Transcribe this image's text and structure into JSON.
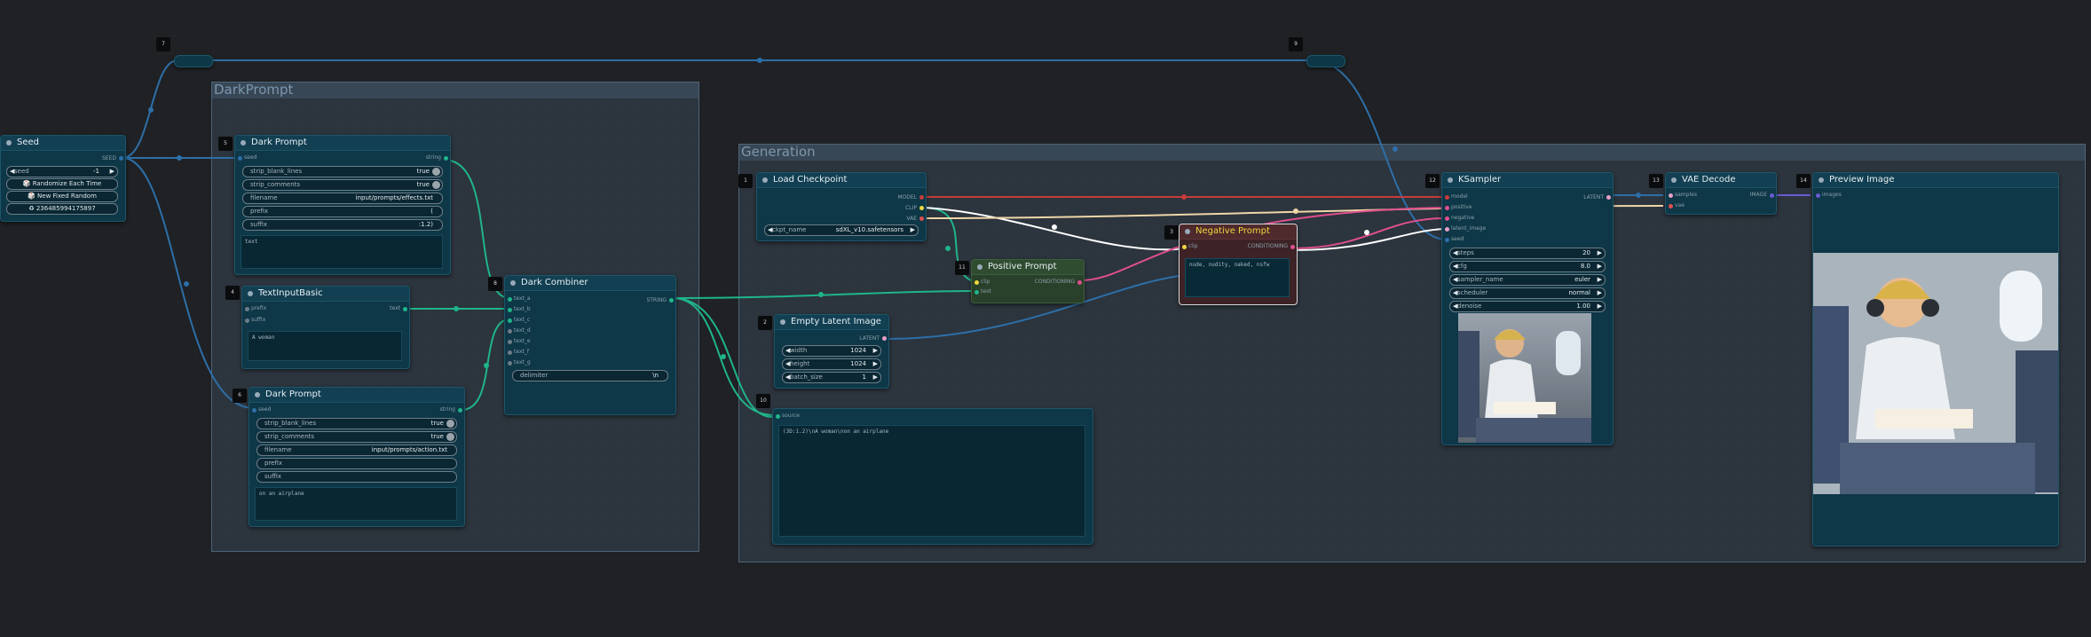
{
  "groups": {
    "dark_prompt": "DarkPrompt",
    "generation": "Generation"
  },
  "seed": {
    "title": "Seed",
    "output": "SEED",
    "seed_label": "seed",
    "seed_value": "-1",
    "btn_randomize": "🎲 Randomize Each Time",
    "btn_new_fixed": "🎲 New Fixed Random",
    "last_seed": "♻ 236485994175897"
  },
  "dark_prompt_1": {
    "id": "5",
    "title": "Dark Prompt",
    "in_seed": "seed",
    "out": "string",
    "strip_blank": "strip_blank_lines",
    "strip_blank_val": "true",
    "strip_comments": "strip_comments",
    "strip_comments_val": "true",
    "filename": "filename",
    "filename_val": "input/prompts/effects.txt",
    "prefix": "prefix",
    "prefix_val": "(",
    "suffix": "suffix",
    "suffix_val": ":1.2)",
    "text": "text"
  },
  "text_input": {
    "id": "4",
    "title": "TextInputBasic",
    "in_prefix": "prefix",
    "in_suffix": "suffix",
    "out": "text",
    "text": "A woman"
  },
  "dark_prompt_2": {
    "id": "6",
    "title": "Dark Prompt",
    "in_seed": "seed",
    "out": "string",
    "strip_blank": "strip_blank_lines",
    "strip_blank_val": "true",
    "strip_comments": "strip_comments",
    "strip_comments_val": "true",
    "filename": "filename",
    "filename_val": "input/prompts/action.txt",
    "prefix": "prefix",
    "suffix": "suffix",
    "text": "on an airplane"
  },
  "combiner": {
    "id": "8",
    "title": "Dark Combiner",
    "inputs": [
      "text_a",
      "text_b",
      "text_c",
      "text_d",
      "text_e",
      "text_f",
      "text_g"
    ],
    "out": "STRING",
    "delimiter": "delimiter",
    "delimiter_val": "\\n"
  },
  "load_checkpoint": {
    "id": "1",
    "title": "Load Checkpoint",
    "out_model": "MODEL",
    "out_clip": "CLIP",
    "out_vae": "VAE",
    "ckpt_label": "ckpt_name",
    "ckpt_value": "sdXL_v10.safetensors"
  },
  "positive": {
    "id": "11",
    "title": "Positive Prompt",
    "in_clip": "clip",
    "in_text": "text",
    "out": "CONDITIONING"
  },
  "negative": {
    "id": "3",
    "title": "Negative Prompt",
    "in_clip": "clip",
    "out": "CONDITIONING",
    "text": "nude, nudity, naked, nsfw"
  },
  "empty_latent": {
    "id": "2",
    "title": "Empty Latent Image",
    "out": "LATENT",
    "width_label": "width",
    "width": "1024",
    "height_label": "height",
    "height": "1024",
    "batch_label": "batch_size",
    "batch": "1"
  },
  "text_node": {
    "id": "10",
    "in_source": "source",
    "text": "(3D:1.2)\\nA woman\\non an airplane"
  },
  "ksampler": {
    "id": "12",
    "title": "KSampler",
    "inputs": [
      "model",
      "positive",
      "negative",
      "latent_image",
      "seed"
    ],
    "out": "LATENT",
    "steps_label": "steps",
    "steps": "20",
    "cfg_label": "cfg",
    "cfg": "8.0",
    "sampler_label": "sampler_name",
    "sampler": "euler",
    "scheduler_label": "scheduler",
    "scheduler": "normal",
    "denoise_label": "denoise",
    "denoise": "1.00"
  },
  "vae_decode": {
    "id": "13",
    "title": "VAE Decode",
    "in_samples": "samples",
    "in_vae": "vae",
    "out": "IMAGE"
  },
  "preview": {
    "id": "14",
    "title": "Preview Image",
    "in_images": "images"
  },
  "reroute_1": {
    "id": "7"
  },
  "reroute_2": {
    "id": "9"
  }
}
